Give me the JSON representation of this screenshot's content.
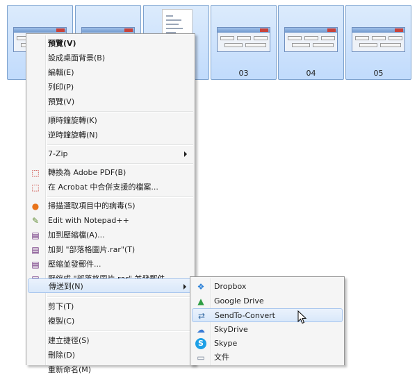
{
  "thumbnails": [
    {
      "caption": "",
      "kind": "dialog"
    },
    {
      "caption": "",
      "kind": "dialog"
    },
    {
      "caption": "",
      "kind": "document"
    },
    {
      "caption": "03",
      "kind": "dialog"
    },
    {
      "caption": "04",
      "kind": "dialog"
    },
    {
      "caption": "05",
      "kind": "dialog"
    }
  ],
  "context_menu": {
    "items": [
      {
        "label": "預覽(V)",
        "bold": true
      },
      {
        "label": "設成桌面背景(B)"
      },
      {
        "label": "編輯(E)"
      },
      {
        "label": "列印(P)"
      },
      {
        "label": "預覽(V)"
      },
      {
        "label": "順時鐘旋轉(K)"
      },
      {
        "label": "逆時鐘旋轉(N)"
      },
      {
        "label": "7-Zip",
        "submenu": true
      },
      {
        "label": "轉換為 Adobe PDF(B)",
        "icon": "adobe-pdf-icon",
        "icon_glyph": "⬚",
        "icon_color": "#c4271f"
      },
      {
        "label": "在 Acrobat 中合併支援的檔案...",
        "icon": "acrobat-combine-icon",
        "icon_glyph": "⬚",
        "icon_color": "#c4271f"
      },
      {
        "label": "掃描選取項目中的病毒(S)",
        "icon": "antivirus-scan-icon",
        "icon_glyph": "●",
        "icon_color": "#e8731a"
      },
      {
        "label": "Edit with Notepad++",
        "icon": "notepad-plus-plus-icon",
        "icon_glyph": "✎",
        "icon_color": "#5c8a2e"
      },
      {
        "label": "加到壓縮檔(A)...",
        "icon": "winrar-icon",
        "icon_glyph": "▤",
        "icon_color": "#6a2c7a"
      },
      {
        "label": "加到 \"部落格圖片.rar\"(T)",
        "icon": "winrar-icon",
        "icon_glyph": "▤",
        "icon_color": "#6a2c7a"
      },
      {
        "label": "壓縮並發郵件...",
        "icon": "winrar-icon",
        "icon_glyph": "▤",
        "icon_color": "#6a2c7a"
      },
      {
        "label": "壓縮成 \"部落格圖片.rar\" 並發郵件",
        "icon": "winrar-icon",
        "icon_glyph": "▤",
        "icon_color": "#6a2c7a"
      },
      {
        "label": "傳送到(N)",
        "submenu": true,
        "highlighted": true
      },
      {
        "label": "剪下(T)"
      },
      {
        "label": "複製(C)"
      },
      {
        "label": "建立捷徑(S)"
      },
      {
        "label": "刪除(D)"
      },
      {
        "label": "重新命名(M)"
      }
    ]
  },
  "send_to_menu": {
    "items": [
      {
        "label": "Dropbox",
        "icon": "dropbox-icon",
        "icon_glyph": "❖",
        "icon_color": "#2d82d8"
      },
      {
        "label": "Google Drive",
        "icon": "google-drive-icon",
        "icon_glyph": "▲",
        "icon_color": "#2f9e44"
      },
      {
        "label": "SendTo-Convert",
        "icon": "sendto-convert-icon",
        "icon_glyph": "⇄",
        "icon_color": "#3a6ea5",
        "highlighted": true
      },
      {
        "label": "SkyDrive",
        "icon": "skydrive-icon",
        "icon_glyph": "☁",
        "icon_color": "#3a7bd5"
      },
      {
        "label": "Skype",
        "icon": "skype-icon",
        "icon_glyph": "S",
        "icon_color": "#ffffff",
        "icon_bg": "#1ea0e6"
      },
      {
        "label": "文件",
        "icon": "documents-icon",
        "icon_glyph": "▭",
        "icon_color": "#6b7a90"
      }
    ]
  },
  "colors": {
    "selection_border": "#a8c6ee",
    "thumb_border": "#7da2ce",
    "menu_bg": "#f5f5f5"
  }
}
